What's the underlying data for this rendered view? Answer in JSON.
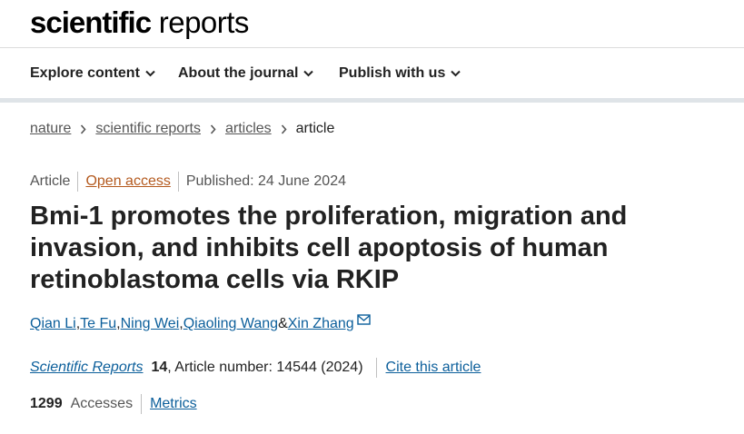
{
  "site": {
    "logo_bold": "scientific",
    "logo_light": " reports"
  },
  "nav": {
    "items": [
      {
        "label": "Explore content"
      },
      {
        "label": "About the journal"
      },
      {
        "label": "Publish with us"
      }
    ]
  },
  "breadcrumb": [
    "nature",
    "scientific reports",
    "articles",
    "article"
  ],
  "meta": {
    "type": "Article",
    "open_access": "Open access",
    "published": "Published: 24 June 2024"
  },
  "article": {
    "title": "Bmi-1 promotes the proliferation, migration and invasion, and inhibits cell apoptosis of human retinoblastoma cells via RKIP",
    "authors": [
      "Qian Li",
      "Te Fu",
      "Ning Wei",
      "Qiaoling Wang",
      "Xin Zhang"
    ],
    "author_sep": ", ",
    "author_and": " & ",
    "journal": "Scientific Reports",
    "volume": "14",
    "article_info": ", Article number: 14544 (2024)",
    "cite_link": "Cite this article"
  },
  "stats": {
    "accesses_count": "1299",
    "accesses_label": "Accesses",
    "metrics_link": "Metrics"
  },
  "colors": {
    "link": "#0c5f9b",
    "open_access": "#b45a1f",
    "nav_border": "#dfe4e8"
  },
  "icons": {
    "nav_chevron": "chevron-down-icon",
    "breadcrumb_sep": "chevron-right-icon",
    "corresponding": "envelope-icon"
  }
}
